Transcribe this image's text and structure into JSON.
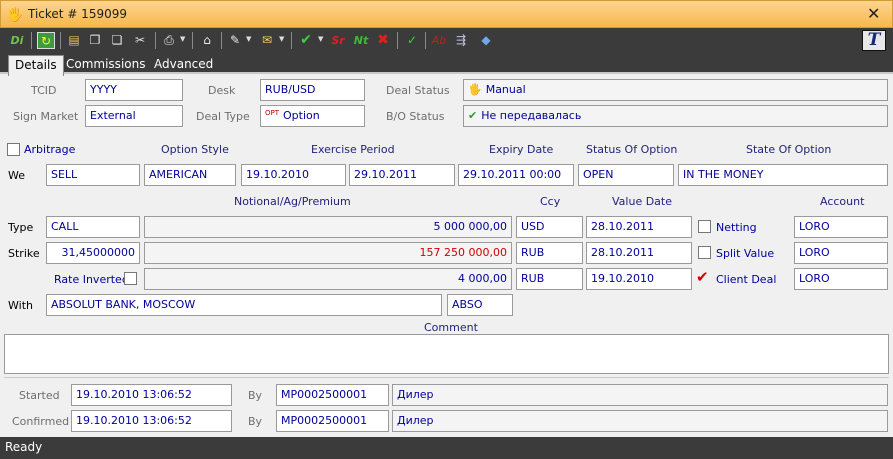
{
  "window": {
    "title": "Ticket # 159099",
    "close": "✕"
  },
  "toolbar": {
    "logo": "T",
    "buttons": [
      "Di",
      "Sr",
      "Nt",
      "Ab"
    ]
  },
  "tabs": [
    "Details",
    "Commissions",
    "Advanced"
  ],
  "row1": {
    "tcid_label": "TCID",
    "tcid": "YYYY",
    "desk_label": "Desk",
    "desk": "RUB/USD",
    "deal_status_label": "Deal Status",
    "deal_status": "Manual"
  },
  "row2": {
    "sign_market_label": "Sign Market",
    "sign_market": "External",
    "deal_type_label": "Deal Type",
    "deal_type_icon": "OPT",
    "deal_type": "Option",
    "bo_status_label": "B/O Status",
    "bo_status": "Не передавалась"
  },
  "arbitrage_label": "Arbitrage",
  "option_headers": {
    "option_style": "Option Style",
    "exercise_period": "Exercise Period",
    "expiry_date": "Expiry Date",
    "status_of_option": "Status Of Option",
    "state_of_option": "State Of Option"
  },
  "we_row": {
    "label": "We",
    "side": "SELL",
    "option_style": "AMERICAN",
    "exercise_from": "19.10.2010",
    "exercise_to": "29.10.2011",
    "expiry": "29.10.2011 00:00",
    "status": "OPEN",
    "state": "IN THE MONEY"
  },
  "amount_headers": {
    "notional": "Notional/Ag/Premium",
    "ccy": "Ccy",
    "value_date": "Value Date",
    "account": "Account"
  },
  "type_row": {
    "label": "Type",
    "type": "CALL",
    "amount": "5 000 000,00",
    "ccy": "USD",
    "value_date": "28.10.2011",
    "check_label": "Netting",
    "account": "LORO"
  },
  "strike_row": {
    "label": "Strike",
    "strike": "31,45000000",
    "amount": "157 250 000,00",
    "ccy": "RUB",
    "value_date": "28.10.2011",
    "check_label": "Split Value",
    "account": "LORO"
  },
  "premium_row": {
    "label": "Rate Inverted",
    "amount": "4 000,00",
    "ccy": "RUB",
    "value_date": "19.10.2010",
    "check_label": "Client Deal",
    "account": "LORO"
  },
  "with_row": {
    "label": "With",
    "counterparty": "ABSOLUT BANK, MOSCOW",
    "code": "ABSO"
  },
  "comment_label": "Comment",
  "started": {
    "label": "Started",
    "datetime": "19.10.2010 13:06:52",
    "by_label": "By",
    "user": "MP0002500001",
    "role": "Дилер"
  },
  "confirmed": {
    "label": "Confirmed",
    "datetime": "19.10.2010 13:06:52",
    "by_label": "By",
    "user": "MP0002500001",
    "role": "Дилер"
  },
  "status": "Ready",
  "colors": {
    "title_bar": "#f7b74d",
    "toolbar": "#3b3b3b",
    "field_text": "#00009a",
    "red_value": "#d00000",
    "header_text": "#1f1f7a"
  }
}
